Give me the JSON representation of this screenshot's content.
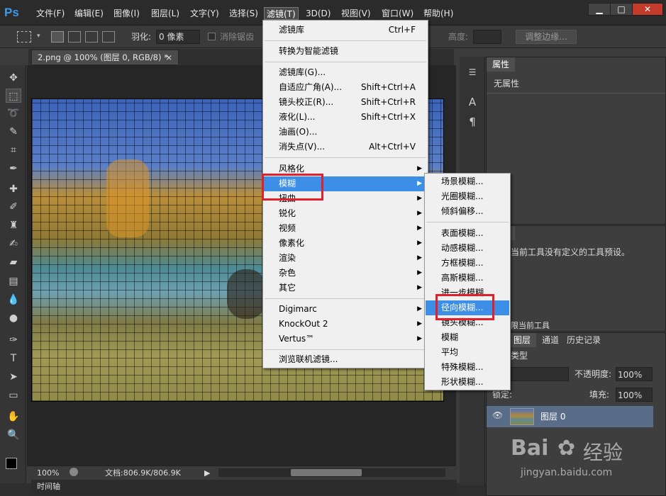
{
  "menubar": {
    "logo": "Ps",
    "items": [
      "文件(F)",
      "编辑(E)",
      "图像(I)",
      "图层(L)",
      "文字(Y)",
      "选择(S)",
      "滤镜(T)",
      "3D(D)",
      "视图(V)",
      "窗口(W)",
      "帮助(H)"
    ],
    "window_buttons": {
      "minimize": "▁",
      "maximize": "□",
      "close": "✕"
    }
  },
  "options": {
    "feather_label": "羽化:",
    "feather_value": "0 像素",
    "antialias_label": "消除锯齿",
    "height_label": "高度:",
    "refine_edge_button": "调整边缘..."
  },
  "document": {
    "tab_title": "2.png @ 100% (图层 0, RGB/8) *",
    "tab_close": "×"
  },
  "status": {
    "zoom": "100%",
    "doc_info": "文档:806.9K/806.9K",
    "timeline": "时间轴"
  },
  "filter_menu": {
    "group1": [
      {
        "label": "滤镜库",
        "shortcut": "Ctrl+F"
      }
    ],
    "group2": [
      {
        "label": "转换为智能滤镜"
      }
    ],
    "group3": [
      {
        "label": "滤镜库(G)..."
      },
      {
        "label": "自适应广角(A)...",
        "shortcut": "Shift+Ctrl+A"
      },
      {
        "label": "镜头校正(R)...",
        "shortcut": "Shift+Ctrl+R"
      },
      {
        "label": "液化(L)...",
        "shortcut": "Shift+Ctrl+X"
      },
      {
        "label": "油画(O)..."
      },
      {
        "label": "消失点(V)...",
        "shortcut": "Alt+Ctrl+V"
      }
    ],
    "group4": [
      {
        "label": "风格化"
      },
      {
        "label": "模糊"
      },
      {
        "label": "扭曲"
      },
      {
        "label": "锐化"
      },
      {
        "label": "视频"
      },
      {
        "label": "像素化"
      },
      {
        "label": "渲染"
      },
      {
        "label": "杂色"
      },
      {
        "label": "其它"
      }
    ],
    "group5": [
      {
        "label": "Digimarc"
      },
      {
        "label": "KnockOut 2"
      },
      {
        "label": "Vertus™"
      }
    ],
    "group6": [
      {
        "label": "浏览联机滤镜..."
      }
    ]
  },
  "blur_submenu": {
    "group1": [
      "场景模糊...",
      "光圈模糊...",
      "倾斜偏移..."
    ],
    "group2": [
      "表面模糊...",
      "动感模糊...",
      "方框模糊...",
      "高斯模糊...",
      "进一步模糊",
      "径向模糊...",
      "镜头模糊...",
      "模糊",
      "平均",
      "特殊模糊...",
      "形状模糊..."
    ]
  },
  "properties_panel": {
    "tab": "属性",
    "content": "无属性"
  },
  "presets_panel": {
    "tab": "预设",
    "message": "当前工具没有定义的工具预设。",
    "option": "限当前工具"
  },
  "layers_panel": {
    "tabs": [
      "图层",
      "通道",
      "历史记录"
    ],
    "filter_kind": "类型",
    "opacity_label": "不透明度:",
    "opacity_value": "100%",
    "lock_label": "锁定:",
    "fill_label": "填充:",
    "fill_value": "100%",
    "layer_name": "图层 0"
  },
  "watermark": {
    "brand": "Bai",
    "brand2": "经验",
    "url": "jingyan.baidu.com"
  },
  "accent_color": "#3d8ee6",
  "highlight_box_color": "#e0202a"
}
